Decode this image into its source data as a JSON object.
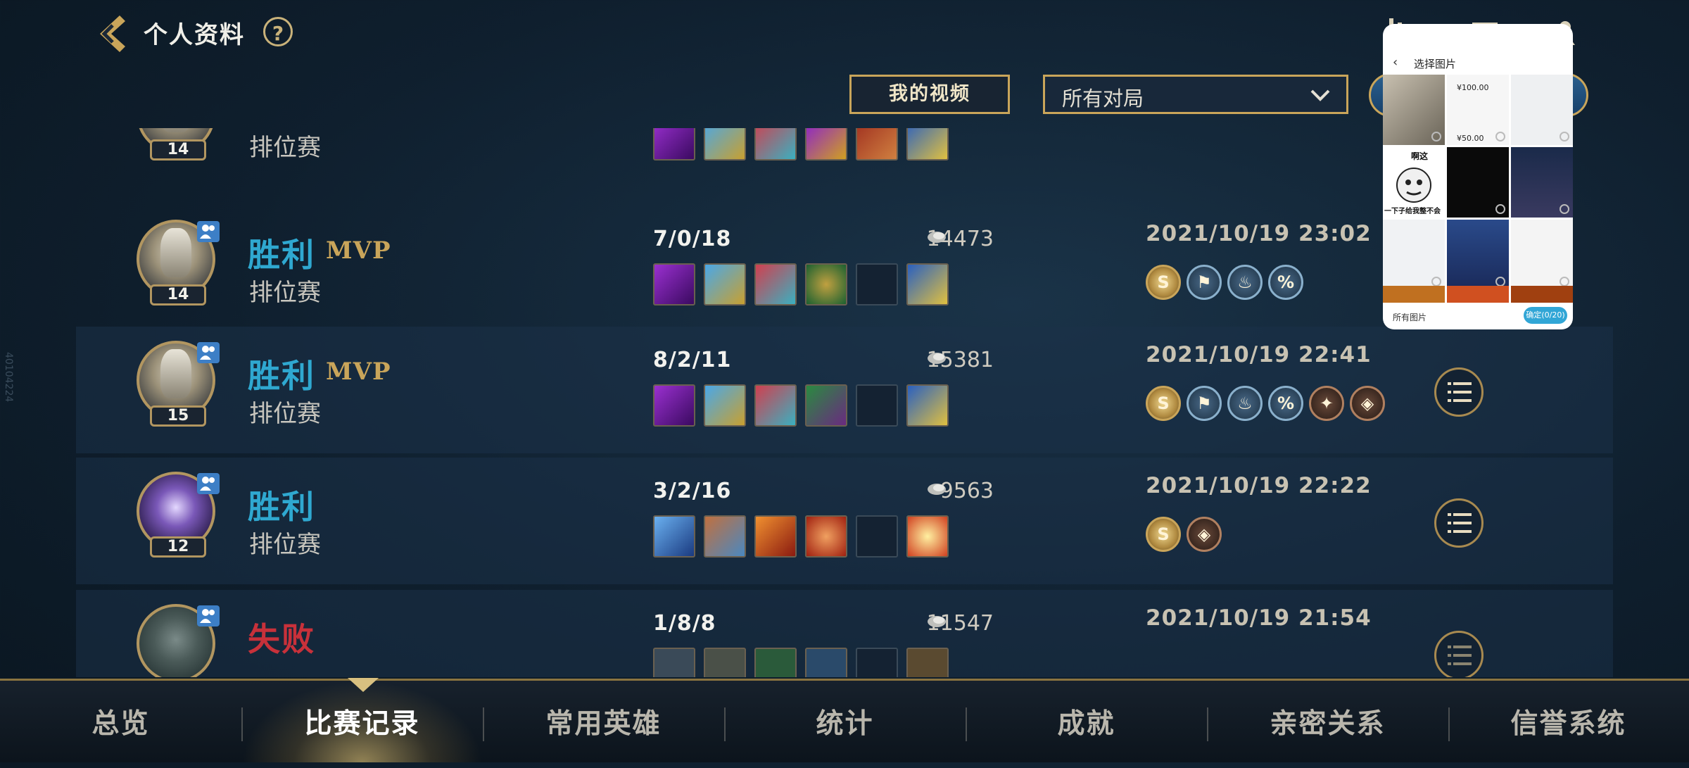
{
  "header": {
    "title": "个人资料",
    "help": "?"
  },
  "toolbar": {
    "my_videos": "我的视频",
    "filter_value": "所有对局"
  },
  "matches": [
    {
      "result": "",
      "mvp": "",
      "mode": "排位赛",
      "level": "14",
      "kda": "",
      "score": "",
      "date": ""
    },
    {
      "result": "胜利",
      "mvp": "MVP",
      "mode": "排位赛",
      "level": "14",
      "kda": "7/0/18",
      "score": "14473",
      "date": "2021/10/19 23:02"
    },
    {
      "result": "胜利",
      "mvp": "MVP",
      "mode": "排位赛",
      "level": "15",
      "kda": "8/2/11",
      "score": "15381",
      "date": "2021/10/19 22:41"
    },
    {
      "result": "胜利",
      "mvp": "",
      "mode": "排位赛",
      "level": "12",
      "kda": "3/2/16",
      "score": "9563",
      "date": "2021/10/19 22:22"
    },
    {
      "result": "失败",
      "mvp": "",
      "mode": "",
      "level": "",
      "kda": "1/8/8",
      "score": "11547",
      "date": "2021/10/19 21:54"
    }
  ],
  "badges": {
    "s": "S"
  },
  "tabs": [
    "总览",
    "比赛记录",
    "常用英雄",
    "统计",
    "成就",
    "亲密关系",
    "信誉系统"
  ],
  "active_tab": "比赛记录",
  "picker": {
    "title": "选择图片",
    "cell_texts": [
      "¥100.00",
      "¥50.00",
      "啊这",
      "一下子给我整不会了"
    ],
    "footer_label": "所有图片",
    "confirm": "确定(0/20)"
  },
  "side_watermark": "40104224",
  "colors": {
    "win": "#2fa8d0",
    "loss": "#c8313a",
    "accent_gold": "#c9a55a"
  }
}
